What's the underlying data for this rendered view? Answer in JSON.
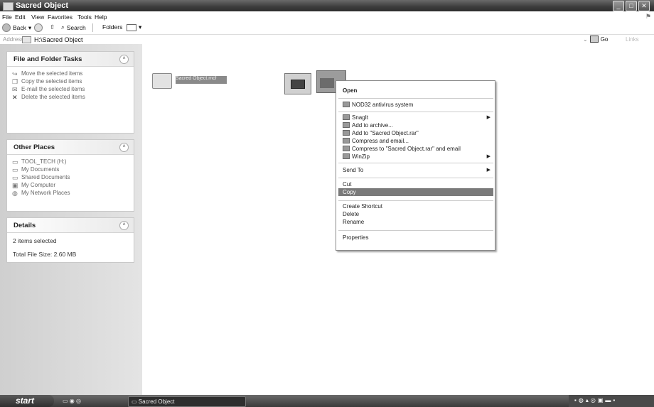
{
  "window": {
    "title": "Sacred Object"
  },
  "menu": [
    "File",
    "Edit",
    "View",
    "Favorites",
    "Tools",
    "Help"
  ],
  "toolbar": {
    "back": "Back",
    "search": "Search",
    "folders": "Folders"
  },
  "address": {
    "label": "Address",
    "path": "H:\\Sacred Object",
    "go": "Go",
    "links": "Links"
  },
  "file_tasks": {
    "title": "File and Folder Tasks",
    "items": [
      "Move the selected items",
      "Copy the selected items",
      "E-mail the selected items",
      "Delete the selected items"
    ]
  },
  "other_places": {
    "title": "Other Places",
    "items": [
      "TOOL_TECH (H:)",
      "My Documents",
      "Shared Documents",
      "My Computer",
      "My Network Places"
    ]
  },
  "details": {
    "title": "Details",
    "selected": "2 items selected",
    "size": "Total File Size: 2.60 MB"
  },
  "files": {
    "selected_name": "Sacred Object.mcf"
  },
  "context_menu": {
    "items": [
      "Open",
      "NOD32 antivirus system",
      "SnagIt",
      "Add to archive...",
      "Add to \"Sacred Object.rar\"",
      "Compress and email...",
      "Compress to \"Sacred Object.rar\" and email",
      "WinZip",
      "Send To",
      "Cut",
      "Copy",
      "Create Shortcut",
      "Delete",
      "Rename",
      "Properties"
    ],
    "highlighted": "Copy"
  },
  "taskbar": {
    "start": "start",
    "task": "Sacred Object"
  }
}
